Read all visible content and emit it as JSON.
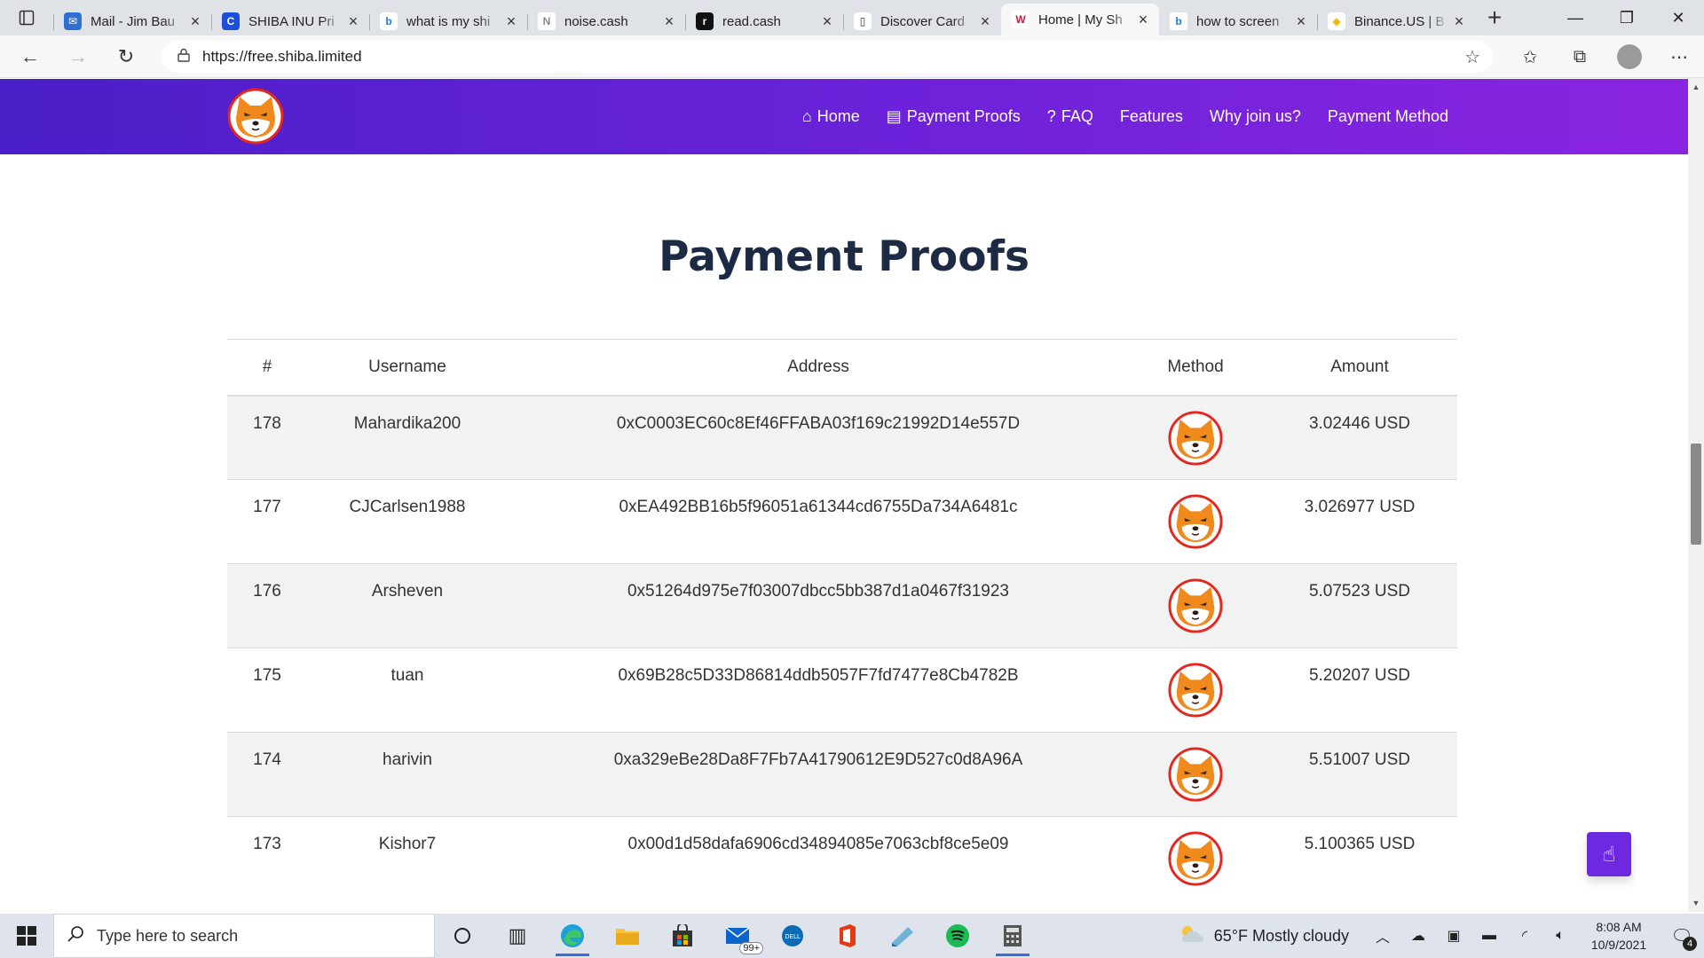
{
  "browser": {
    "tabs": [
      {
        "title": "Mail - Jim Bau",
        "fav_bg": "#2f6fd1",
        "fav_color": "#fff",
        "fav_glyph": "✉",
        "icon": "outlook-icon"
      },
      {
        "title": "SHIBA INU Pri",
        "fav_bg": "#1d4ed8",
        "fav_color": "#fff",
        "fav_glyph": "C",
        "icon": "coinmarketcap-icon"
      },
      {
        "title": "what is my shi",
        "fav_bg": "#ffffff",
        "fav_color": "#1b7ed6",
        "fav_glyph": "b",
        "icon": "bing-icon"
      },
      {
        "title": "noise.cash",
        "fav_bg": "#ffffff",
        "fav_color": "#888",
        "fav_glyph": "N",
        "icon": "noisecash-icon"
      },
      {
        "title": "read.cash",
        "fav_bg": "#111",
        "fav_color": "#fff",
        "fav_glyph": "r",
        "icon": "readcash-icon"
      },
      {
        "title": "Discover Card",
        "fav_bg": "#ffffff",
        "fav_color": "#333",
        "fav_glyph": "▯",
        "icon": "document-icon"
      },
      {
        "title": "Home | My Sh",
        "fav_bg": "#ffffff",
        "fav_color": "#c41e3a",
        "fav_glyph": "W",
        "icon": "wix-icon",
        "active": true
      },
      {
        "title": "how to screen",
        "fav_bg": "#ffffff",
        "fav_color": "#1b7ed6",
        "fav_glyph": "b",
        "icon": "bing-icon"
      },
      {
        "title": "Binance.US | B",
        "fav_bg": "#ffffff",
        "fav_color": "#f0b90b",
        "fav_glyph": "◆",
        "icon": "binance-icon"
      }
    ],
    "url": "https://free.shiba.limited"
  },
  "site": {
    "nav": [
      {
        "label": "Home",
        "icon": "home-icon",
        "glyph": "⌂"
      },
      {
        "label": "Payment Proofs",
        "icon": "id-card-icon",
        "glyph": "▤"
      },
      {
        "label": "FAQ",
        "icon": "question-circle-icon",
        "glyph": "?"
      },
      {
        "label": "Features",
        "icon": "",
        "glyph": ""
      },
      {
        "label": "Why join us?",
        "icon": "",
        "glyph": ""
      },
      {
        "label": "Payment Method",
        "icon": "",
        "glyph": ""
      }
    ],
    "section_title": "Payment Proofs",
    "table": {
      "headers": [
        "#",
        "Username",
        "Address",
        "Method",
        "Amount"
      ],
      "rows": [
        {
          "num": "178",
          "username": "Mahardika200",
          "address": "0xC0003EC60c8Ef46FFABA03f169c21992D14e557D",
          "amount": "3.02446 USD"
        },
        {
          "num": "177",
          "username": "CJCarlsen1988",
          "address": "0xEA492BB16b5f96051a61344cd6755Da734A6481c",
          "amount": "3.026977 USD"
        },
        {
          "num": "176",
          "username": "Arsheven",
          "address": "0x51264d975e7f03007dbcc5bb387d1a0467f31923",
          "amount": "5.07523 USD"
        },
        {
          "num": "175",
          "username": "tuan",
          "address": "0x69B28c5D33D86814ddb5057F7fd7477e8Cb4782B",
          "amount": "5.20207 USD"
        },
        {
          "num": "174",
          "username": "harivin",
          "address": "0xa329eBe28Da8F7Fb7A41790612E9D527c0d8A96A",
          "amount": "5.51007 USD"
        },
        {
          "num": "173",
          "username": "Kishor7",
          "address": "0x00d1d58dafa6906cd34894085e7063cbf8ce5e09",
          "amount": "5.100365 USD"
        }
      ]
    }
  },
  "taskbar": {
    "search_placeholder": "Type here to search",
    "mail_badge": "99+",
    "weather": "65°F  Mostly cloudy",
    "time": "8:08 AM",
    "date": "10/9/2021",
    "notification_count": "4"
  },
  "colors": {
    "header_gradient_start": "#4a1fc7",
    "header_gradient_end": "#8a24e0",
    "accent_purple": "#6d28e0",
    "title_navy": "#1d2a44"
  }
}
